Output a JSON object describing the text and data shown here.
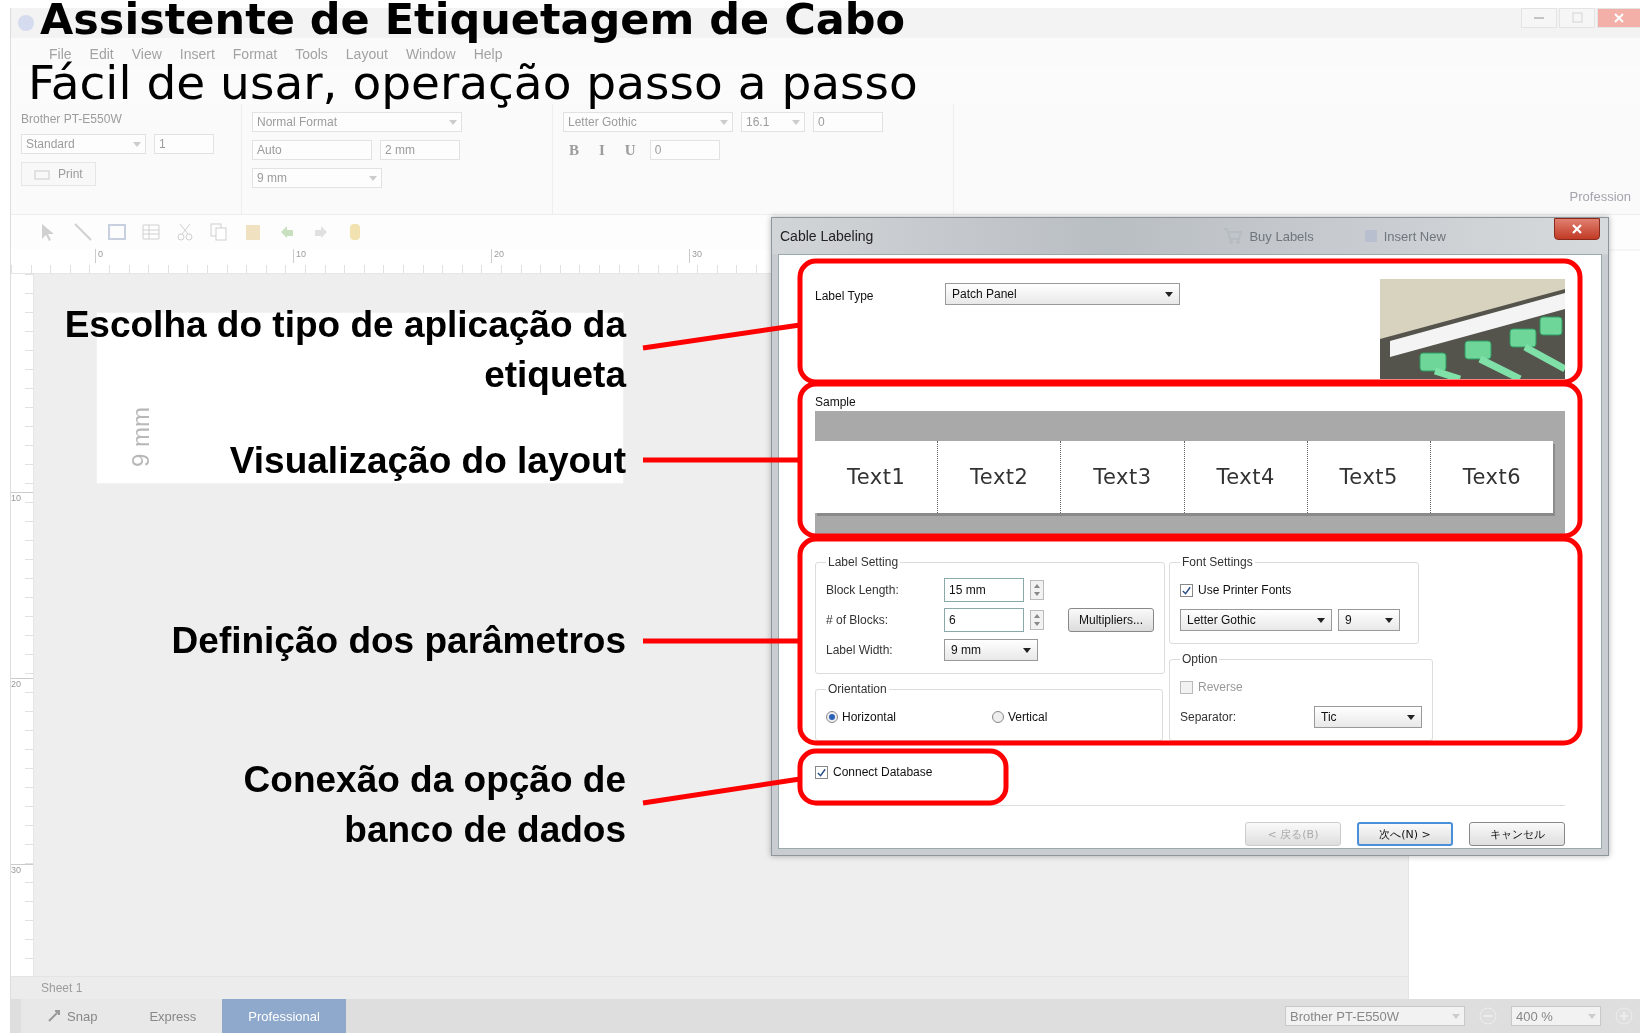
{
  "heading": {
    "title": "Assistente de Etiquetagem de Cabo",
    "subtitle": "Fácil de usar, operação passo a passo"
  },
  "app": {
    "menu": [
      "File",
      "Edit",
      "View",
      "Insert",
      "Format",
      "Tools",
      "Layout",
      "Window",
      "Help"
    ],
    "ribbon": {
      "printer": "Brother PT-E550W",
      "paper": "Standard",
      "copies": "1",
      "print_button": "Print",
      "format": "Normal Format",
      "length": "Auto",
      "margin": "2 mm",
      "width": "9 mm",
      "font": "Letter Gothic",
      "font_size": "16.1",
      "format_buttons": [
        "B",
        "I",
        "U"
      ],
      "spacing": "0",
      "line_spacing": "0",
      "edition": "Profession"
    },
    "ruler_labels": [
      "0",
      "10",
      "20",
      "30"
    ],
    "vruler_labels": [
      "10",
      "20",
      "30"
    ],
    "canvas_label": "9 mm",
    "sheet_tab": "Sheet 1",
    "behind_dialog": [
      "Buy Labels",
      "Insert New"
    ],
    "status_bar": {
      "modes": [
        {
          "label": "Snap",
          "selected": false
        },
        {
          "label": "Express",
          "selected": false
        },
        {
          "label": "Professional",
          "selected": true
        }
      ],
      "printer": "Brother PT-E550W",
      "zoom": "400 %"
    }
  },
  "dialog": {
    "title": "Cable Labeling",
    "label_type": {
      "label": "Label Type",
      "value": "Patch Panel"
    },
    "sample": {
      "label": "Sample",
      "blocks": [
        "Text1",
        "Text2",
        "Text3",
        "Text4",
        "Text5",
        "Text6"
      ]
    },
    "label_setting": {
      "title": "Label Setting",
      "block_length": {
        "label": "Block Length:",
        "value": "15 mm"
      },
      "blocks": {
        "label": "# of Blocks:",
        "value": "6"
      },
      "multipliers_button": "Multipliers...",
      "label_width": {
        "label": "Label Width:",
        "value": "9 mm"
      }
    },
    "orientation": {
      "title": "Orientation",
      "options": [
        {
          "label": "Horizontal",
          "selected": true
        },
        {
          "label": "Vertical",
          "selected": false
        }
      ]
    },
    "font_settings": {
      "title": "Font Settings",
      "use_printer_fonts": {
        "label": "Use Printer Fonts",
        "checked": true
      },
      "font": "Letter Gothic",
      "size": "9"
    },
    "option": {
      "title": "Option",
      "reverse": {
        "label": "Reverse",
        "checked": false,
        "disabled": true
      },
      "separator": {
        "label": "Separator:",
        "value": "Tic"
      }
    },
    "connect_database": {
      "label": "Connect Database",
      "checked": true
    },
    "buttons": [
      {
        "label": "< 戻る(B)",
        "disabled": true,
        "default": false
      },
      {
        "label": "次へ(N) >",
        "disabled": false,
        "default": true
      },
      {
        "label": "キャンセル",
        "disabled": false,
        "default": false
      }
    ]
  },
  "callouts": [
    {
      "text": "Escolha do tipo de aplicação da etiqueta"
    },
    {
      "text": "Visualização do layout"
    },
    {
      "text": "Definição dos parâmetros"
    },
    {
      "text": "Conexão da opção de banco de dados"
    }
  ]
}
